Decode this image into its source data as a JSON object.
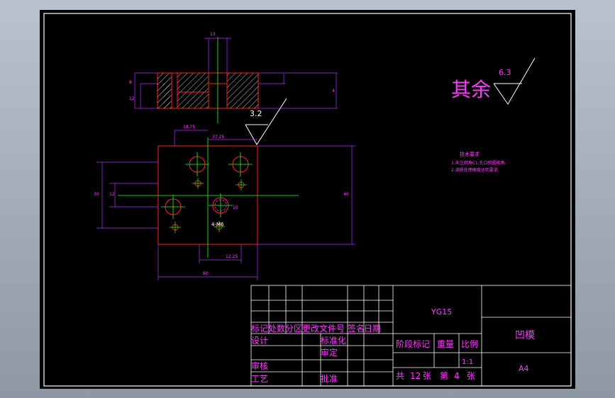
{
  "surface": {
    "main_text": "其余",
    "value": "6.3",
    "local_value": "3.2"
  },
  "dimensions": {
    "top_width": "13",
    "width_18_75": "18.75",
    "width_37_25": "37.25",
    "width_12_25": "12.25",
    "left_height_1": "30",
    "left_height_2": "12",
    "right_height": "40",
    "bottom_width": "60",
    "right_small": "4",
    "left_small_1": "8",
    "left_small_2": "12",
    "hole_small": "10",
    "hole_label": "4-M6"
  },
  "notes": {
    "title": "技术要求",
    "line1": "1.未注倒角C1,孔口倒圆棱角.",
    "line2": "2.调质处理硬度达到要求."
  },
  "title_block": {
    "material": "YG15",
    "part_name": "凹模",
    "row_headers": [
      "标记",
      "处数",
      "分区",
      "更改文件号",
      "签名",
      "日期"
    ],
    "design": "设计",
    "standardize": "标准化",
    "review": "审核",
    "process": "工艺",
    "check": "审定",
    "approve": "批准",
    "stage_mark": "阶段标记",
    "weight": "重量",
    "scale": "比例",
    "scale_value": "1:1",
    "total_label": "共",
    "total_count": "12",
    "sheet_unit": "张",
    "sheet_label": "第",
    "sheet_num": "4",
    "sheet_unit2": "张",
    "paper": "A4"
  }
}
